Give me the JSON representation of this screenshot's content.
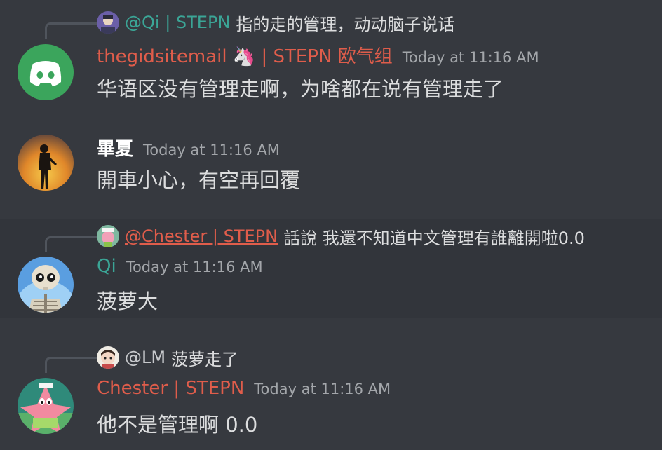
{
  "messages": [
    {
      "reply": {
        "name": "@Qi | STEPN",
        "text": "指的走的管理，动动脑子说话"
      },
      "author": "thegidsitemail 🦄 | STEPN 欧气组",
      "timestamp": "Today at 11:16 AM",
      "content": "华语区没有管理走啊，为啥都在说有管理走了",
      "avatar": "discord-logo-avatar",
      "author_color": "#e05d4b"
    },
    {
      "author": "畢夏",
      "timestamp": "Today at 11:16 AM",
      "content": "開車小心，有空再回覆",
      "avatar": "silhouette-sunset-avatar",
      "author_color": "#ffffff"
    },
    {
      "reply": {
        "name": "@Chester | STEPN",
        "text": "話說 我還不知道中文管理有誰離開啦0.0"
      },
      "author": "Qi",
      "timestamp": "Today at 11:16 AM",
      "content": "菠萝大",
      "avatar": "skeleton-avatar",
      "author_color": "#3ba596"
    },
    {
      "reply": {
        "name": "@LM",
        "text": "菠萝走了"
      },
      "author": "Chester | STEPN",
      "timestamp": "Today at 11:16 AM",
      "content": "他不是管理啊 0.0",
      "avatar": "patrick-star-avatar",
      "author_color": "#e05d4b"
    }
  ]
}
